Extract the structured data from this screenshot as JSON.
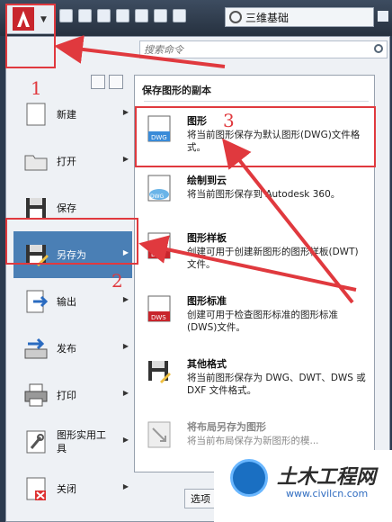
{
  "title_bar": {
    "workspace_label": "三维基础"
  },
  "search": {
    "placeholder": "搜索命令"
  },
  "left_menu": {
    "items": [
      {
        "label": "新建"
      },
      {
        "label": "打开"
      },
      {
        "label": "保存"
      },
      {
        "label": "另存为"
      },
      {
        "label": "输出"
      },
      {
        "label": "发布"
      },
      {
        "label": "打印"
      },
      {
        "label": "图形实用工具"
      },
      {
        "label": "关闭"
      }
    ]
  },
  "save_as_panel": {
    "title": "保存图形的副本",
    "items": [
      {
        "title": "图形",
        "desc": "将当前图形保存为默认图形(DWG)文件格式。"
      },
      {
        "title": "绘制到云",
        "desc": "将当前图形保存到 Autodesk 360。"
      },
      {
        "title": "图形样板",
        "desc": "创建可用于创建新图形的图形样板(DWT)文件。"
      },
      {
        "title": "图形标准",
        "desc": "创建可用于检查图形标准的图形标准(DWS)文件。"
      },
      {
        "title": "其他格式",
        "desc": "将当前图形保存为 DWG、DWT、DWS 或 DXF 文件格式。"
      },
      {
        "title": "将布局另存为图形",
        "desc": "将当前布局保存为新图形的模..."
      }
    ]
  },
  "bottom": {
    "options_label": "选项"
  },
  "annotations": {
    "step1": "1",
    "step2": "2",
    "step3": "3",
    "color": "#e0393e"
  },
  "watermark": {
    "name": "土木工程网",
    "url": "www.civilcn.com"
  }
}
